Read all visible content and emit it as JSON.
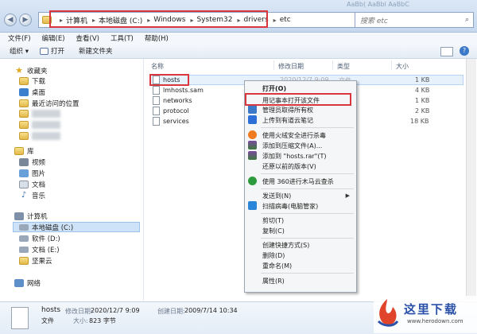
{
  "window": {
    "title_fragment": "AaBb( AaBbl AaBbC"
  },
  "address": {
    "crumbs": [
      "计算机",
      "本地磁盘 (C:)",
      "Windows",
      "System32",
      "drivers",
      "etc"
    ],
    "search_placeholder": "搜索 etc"
  },
  "menubar": [
    "文件(F)",
    "编辑(E)",
    "查看(V)",
    "工具(T)",
    "帮助(H)"
  ],
  "toolbar": {
    "organize": "组织 ▾",
    "open": "打开",
    "new_folder": "新建文件夹"
  },
  "sidebar": {
    "favorites": "收藏夹",
    "downloads": "下载",
    "desktop": "桌面",
    "recent": "最近访问的位置",
    "libraries": "库",
    "videos": "视频",
    "pictures": "图片",
    "documents": "文档",
    "music": "音乐",
    "computer": "计算机",
    "drive_c": "本地磁盘 (C:)",
    "drive_d": "软件 (D:)",
    "drive_e": "文档 (E:)",
    "jianguo": "坚果云",
    "network": "网络"
  },
  "columns": {
    "name": "名称",
    "modified": "修改日期",
    "type": "类型",
    "size": "大小"
  },
  "files": [
    {
      "name": "hosts",
      "date": "2020/12/7 9:09",
      "type": "文件",
      "size": "1 KB"
    },
    {
      "name": "lmhosts.sam",
      "date": "",
      "type": "",
      "size": "4 KB"
    },
    {
      "name": "networks",
      "date": "",
      "type": "",
      "size": "1 KB"
    },
    {
      "name": "protocol",
      "date": "",
      "type": "",
      "size": "2 KB"
    },
    {
      "name": "services",
      "date": "",
      "type": "",
      "size": "18 KB"
    }
  ],
  "context_menu": {
    "open": "打开(O)",
    "open_notepad": "用记事本打开该文件",
    "admin_own": "管理员取得所有权",
    "youdao": "上传到有道云笔记",
    "huorong": "使用火绒安全进行杀毒",
    "add_archive": "添加到压缩文件(A)...",
    "add_rar": "添加到 \"hosts.rar\"(T)",
    "restore": "还原以前的版本(V)",
    "scan360": "使用 360进行木马云查杀",
    "send_to": "发送到(N)",
    "scan_guard": "扫描病毒(电脑管家)",
    "cut": "剪切(T)",
    "copy": "复制(C)",
    "shortcut": "创建快捷方式(S)",
    "delete": "删除(D)",
    "rename": "重命名(M)",
    "properties": "属性(R)"
  },
  "details": {
    "name": "hosts",
    "modified_label": "修改日期:",
    "modified": "2020/12/7 9:09",
    "created_label": "创建日期:",
    "created": "2009/7/14 10:34",
    "type": "文件",
    "size_label": "大小:",
    "size": "823 字节"
  },
  "watermark": {
    "text": "这里下载",
    "url": "www.herodown.com"
  },
  "colors": {
    "highlight_border": "#d9363e",
    "selection": "#e6f1fc",
    "brand": "#2a50a8"
  }
}
